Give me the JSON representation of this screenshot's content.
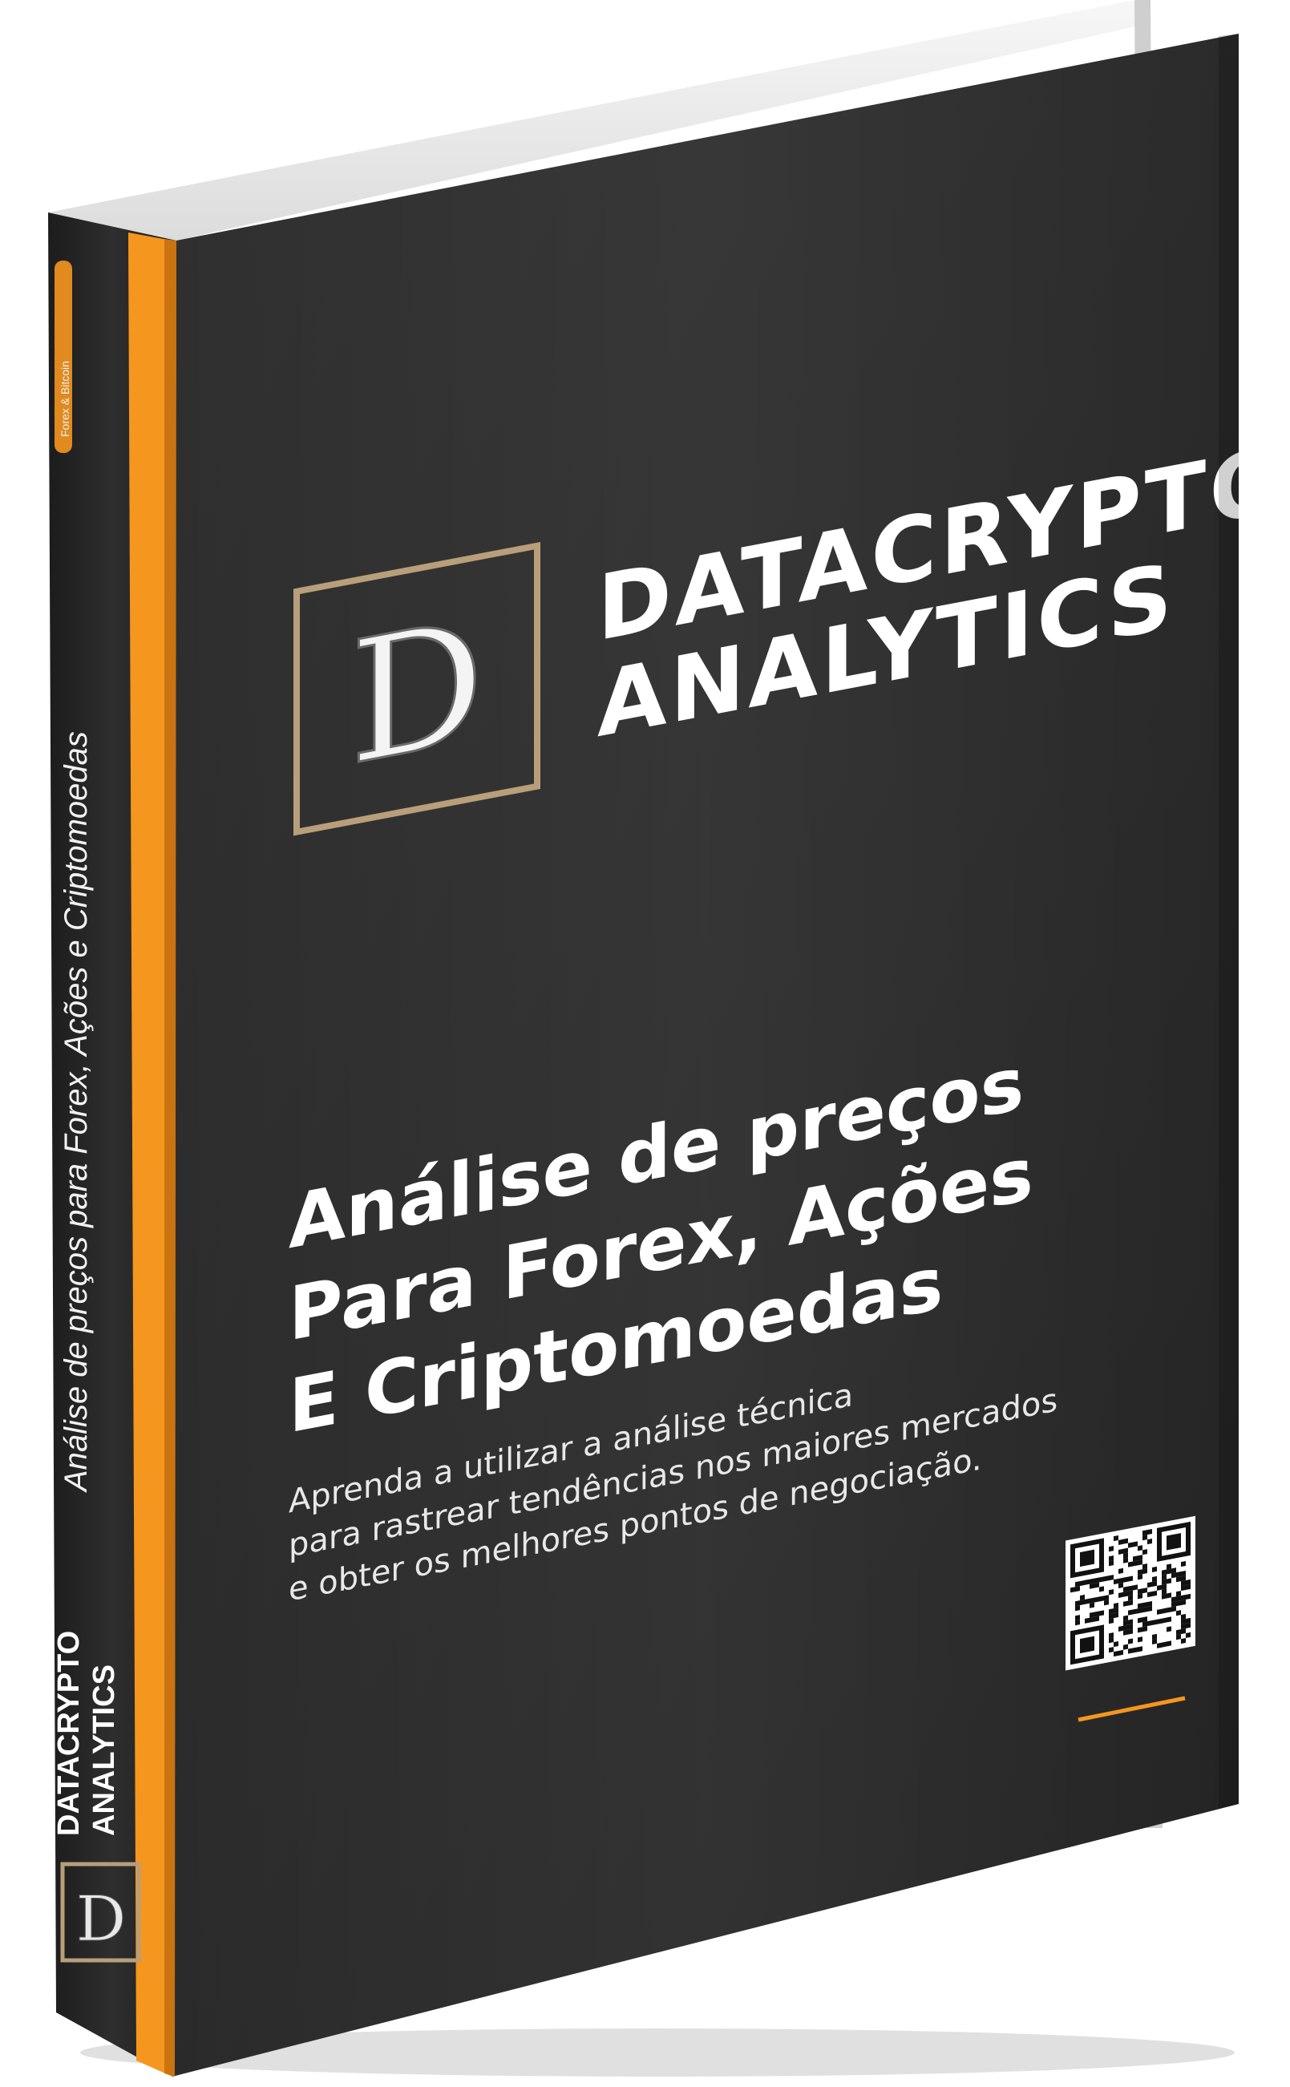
{
  "brand": {
    "line1": "DATACRYPTO",
    "line2": "ANALYTICS",
    "logo_letter": "D"
  },
  "title": {
    "line1": "Análise de preços",
    "line2": "Para Forex, Ações",
    "line3": "E Criptomoedas"
  },
  "subtitle": {
    "line1": "Aprenda a utilizar a análise técnica",
    "line2": "para rastrear tendências nos maiores mercados",
    "line3": "e obter os melhores pontos de negociação."
  },
  "spine": {
    "series_tag": "Forex & Bitcoin",
    "title": "Análise de preços para Forex, Ações e Criptomoedas",
    "brand_line1": "DATACRYPTO",
    "brand_line2": "ANALYTICS",
    "logo_letter": "D"
  },
  "icons": {
    "qr": "qr-code-icon",
    "logo": "logo-d-monogram-icon"
  },
  "colors": {
    "cover": "#2b2b2b",
    "spine": "#262626",
    "accent": "#f5961f",
    "logo_frame": "#b89f7a",
    "pages": "#f2f2f2"
  }
}
